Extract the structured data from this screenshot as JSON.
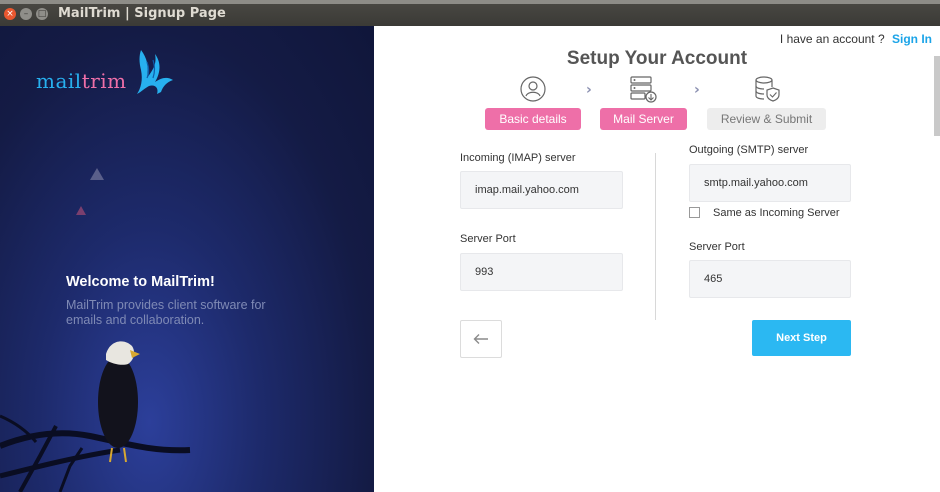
{
  "window": {
    "title": "MailTrim | Signup Page",
    "buttons": {
      "close": "×",
      "minimize": "–",
      "maximize": "□"
    }
  },
  "left_panel": {
    "logo": {
      "text_mail": "mail",
      "text_trim": "trim",
      "icon": "bird-logo-icon"
    },
    "welcome_title": "Welcome to MailTrim!",
    "welcome_subtitle": "MailTrim provides client software for emails and collaboration."
  },
  "header": {
    "have_account": "I have an account ?",
    "sign_in": "Sign In",
    "title": "Setup Your Account"
  },
  "steps": [
    {
      "label": "Basic details",
      "icon": "user-circle-icon",
      "state": "active"
    },
    {
      "label": "Mail Server",
      "icon": "server-icon",
      "state": "active"
    },
    {
      "label": "Review & Submit",
      "icon": "database-shield-icon",
      "state": "inactive"
    }
  ],
  "form": {
    "incoming_label": "Incoming (IMAP) server",
    "incoming_value": "imap.mail.yahoo.com",
    "incoming_port_label": "Server Port",
    "incoming_port_value": "993",
    "outgoing_label": "Outgoing (SMTP) server",
    "outgoing_value": "smtp.mail.yahoo.com",
    "same_as_incoming_label": "Same as Incoming Server",
    "same_as_incoming_checked": false,
    "outgoing_port_label": "Server Port",
    "outgoing_port_value": "465"
  },
  "actions": {
    "back_icon": "arrow-left-icon",
    "next_label": "Next Step"
  },
  "colors": {
    "accent_pink": "#ee6fa8",
    "accent_blue": "#2bb8f2",
    "sign_in_blue": "#1ba4e8",
    "left_bg": "#141b45"
  }
}
